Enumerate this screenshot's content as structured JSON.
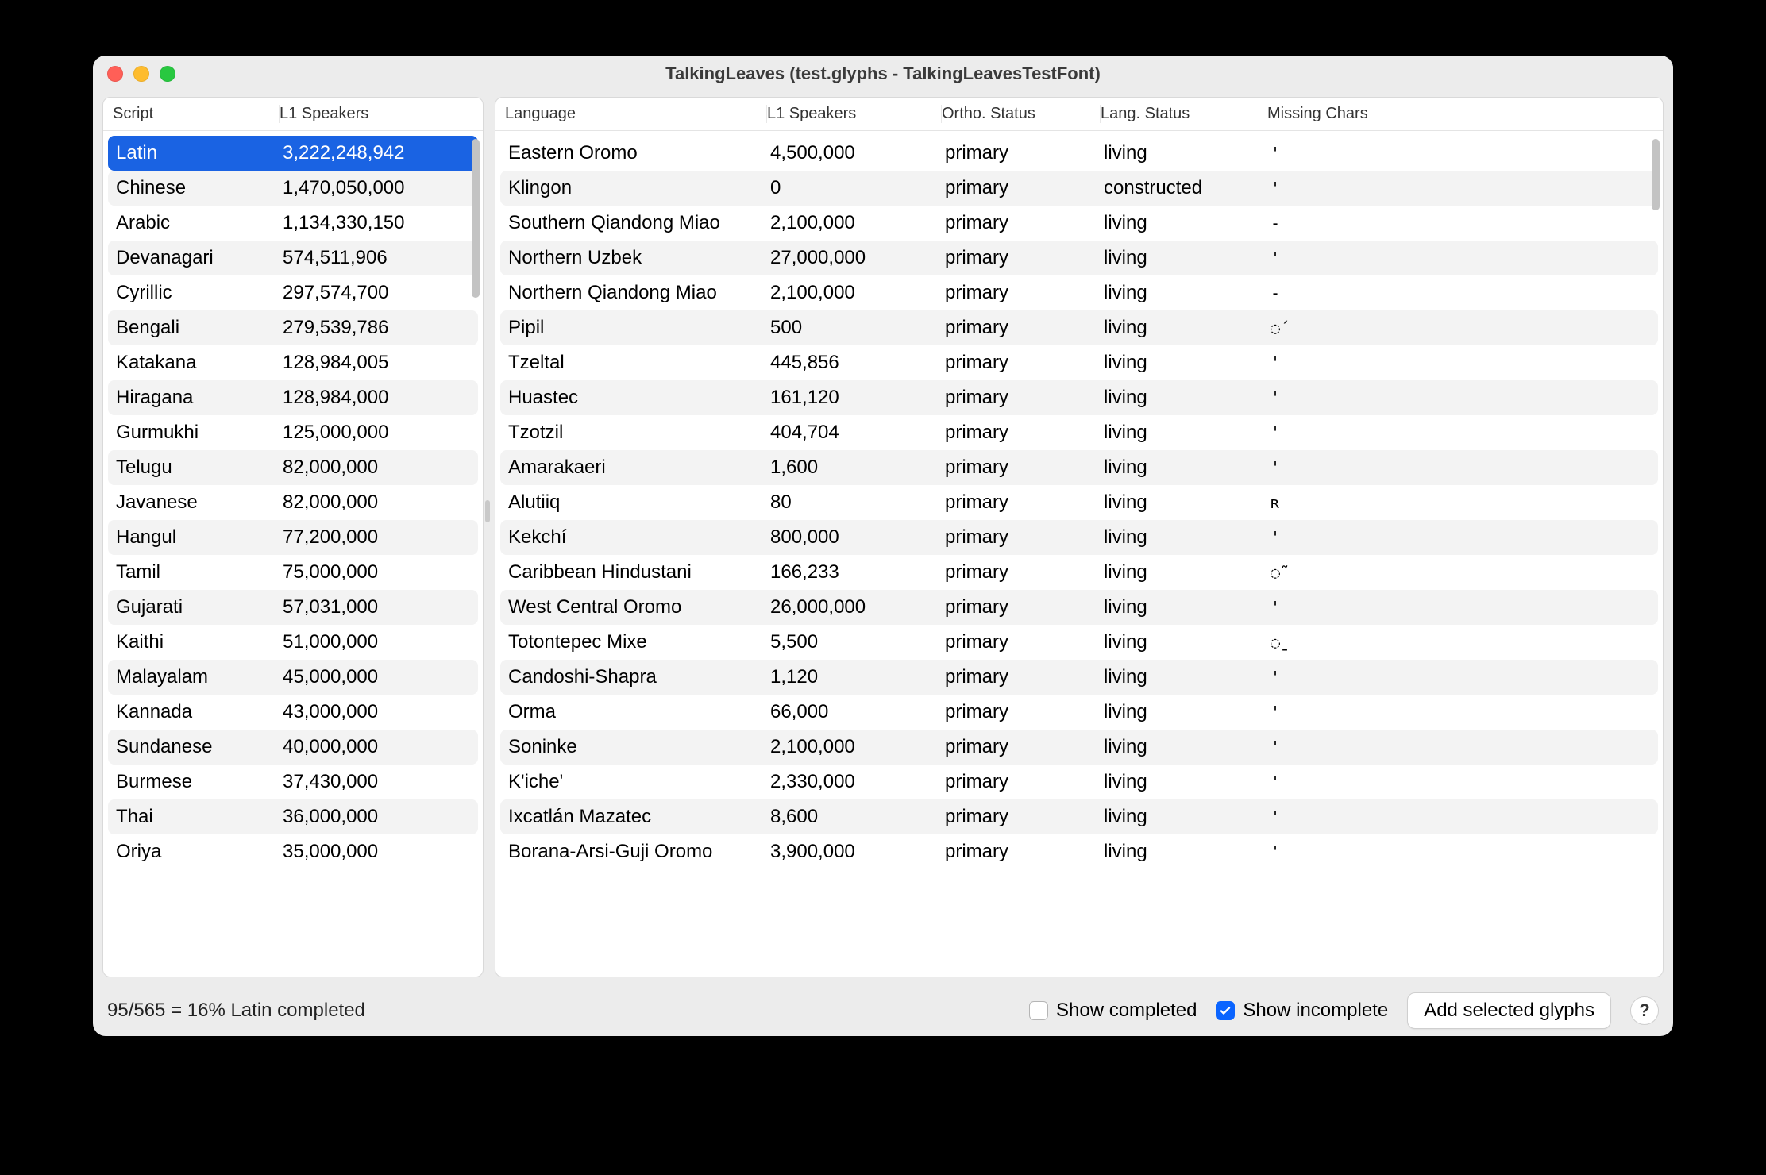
{
  "window": {
    "title": "TalkingLeaves (test.glyphs - TalkingLeavesTestFont)"
  },
  "left": {
    "headers": {
      "script": "Script",
      "speakers": "L1 Speakers"
    },
    "selected_index": 0,
    "rows": [
      {
        "script": "Latin",
        "speakers": "3,222,248,942"
      },
      {
        "script": "Chinese",
        "speakers": "1,470,050,000"
      },
      {
        "script": "Arabic",
        "speakers": "1,134,330,150"
      },
      {
        "script": "Devanagari",
        "speakers": "574,511,906"
      },
      {
        "script": "Cyrillic",
        "speakers": "297,574,700"
      },
      {
        "script": "Bengali",
        "speakers": "279,539,786"
      },
      {
        "script": "Katakana",
        "speakers": "128,984,005"
      },
      {
        "script": "Hiragana",
        "speakers": "128,984,000"
      },
      {
        "script": "Gurmukhi",
        "speakers": "125,000,000"
      },
      {
        "script": "Telugu",
        "speakers": "82,000,000"
      },
      {
        "script": "Javanese",
        "speakers": "82,000,000"
      },
      {
        "script": "Hangul",
        "speakers": "77,200,000"
      },
      {
        "script": "Tamil",
        "speakers": "75,000,000"
      },
      {
        "script": "Gujarati",
        "speakers": "57,031,000"
      },
      {
        "script": "Kaithi",
        "speakers": "51,000,000"
      },
      {
        "script": "Malayalam",
        "speakers": "45,000,000"
      },
      {
        "script": "Kannada",
        "speakers": "43,000,000"
      },
      {
        "script": "Sundanese",
        "speakers": "40,000,000"
      },
      {
        "script": "Burmese",
        "speakers": "37,430,000"
      },
      {
        "script": "Thai",
        "speakers": "36,000,000"
      },
      {
        "script": "Oriya",
        "speakers": "35,000,000"
      }
    ]
  },
  "right": {
    "headers": {
      "language": "Language",
      "speakers": "L1 Speakers",
      "ortho": "Ortho. Status",
      "status": "Lang. Status",
      "missing": "Missing Chars"
    },
    "rows": [
      {
        "language": "Eastern Oromo",
        "speakers": "4,500,000",
        "ortho": "primary",
        "status": "living",
        "missing": "'"
      },
      {
        "language": "Klingon",
        "speakers": "0",
        "ortho": "primary",
        "status": "constructed",
        "missing": "'"
      },
      {
        "language": "Southern Qiandong Miao",
        "speakers": "2,100,000",
        "ortho": "primary",
        "status": "living",
        "missing": "-"
      },
      {
        "language": "Northern Uzbek",
        "speakers": "27,000,000",
        "ortho": "primary",
        "status": "living",
        "missing": "'"
      },
      {
        "language": "Northern Qiandong Miao",
        "speakers": "2,100,000",
        "ortho": "primary",
        "status": "living",
        "missing": "-"
      },
      {
        "language": "Pipil",
        "speakers": "500",
        "ortho": "primary",
        "status": "living",
        "missing": "◌́"
      },
      {
        "language": "Tzeltal",
        "speakers": "445,856",
        "ortho": "primary",
        "status": "living",
        "missing": "'"
      },
      {
        "language": "Huastec",
        "speakers": "161,120",
        "ortho": "primary",
        "status": "living",
        "missing": "'"
      },
      {
        "language": "Tzotzil",
        "speakers": "404,704",
        "ortho": "primary",
        "status": "living",
        "missing": "'"
      },
      {
        "language": "Amarakaeri",
        "speakers": "1,600",
        "ortho": "primary",
        "status": "living",
        "missing": "'"
      },
      {
        "language": "Alutiiq",
        "speakers": "80",
        "ortho": "primary",
        "status": "living",
        "missing": "ʀ"
      },
      {
        "language": "Kekchí",
        "speakers": "800,000",
        "ortho": "primary",
        "status": "living",
        "missing": "'"
      },
      {
        "language": "Caribbean Hindustani",
        "speakers": "166,233",
        "ortho": "primary",
        "status": "living",
        "missing": "◌̃"
      },
      {
        "language": "West Central Oromo",
        "speakers": "26,000,000",
        "ortho": "primary",
        "status": "living",
        "missing": "'"
      },
      {
        "language": "Totontepec Mixe",
        "speakers": "5,500",
        "ortho": "primary",
        "status": "living",
        "missing": "◌̱"
      },
      {
        "language": "Candoshi-Shapra",
        "speakers": "1,120",
        "ortho": "primary",
        "status": "living",
        "missing": "'"
      },
      {
        "language": "Orma",
        "speakers": "66,000",
        "ortho": "primary",
        "status": "living",
        "missing": "'"
      },
      {
        "language": "Soninke",
        "speakers": "2,100,000",
        "ortho": "primary",
        "status": "living",
        "missing": "'"
      },
      {
        "language": "K'iche'",
        "speakers": "2,330,000",
        "ortho": "primary",
        "status": "living",
        "missing": "'"
      },
      {
        "language": "Ixcatlán Mazatec",
        "speakers": "8,600",
        "ortho": "primary",
        "status": "living",
        "missing": "'"
      },
      {
        "language": "Borana-Arsi-Guji Oromo",
        "speakers": "3,900,000",
        "ortho": "primary",
        "status": "living",
        "missing": "'"
      }
    ]
  },
  "footer": {
    "status": "95/565 = 16% Latin completed",
    "show_completed": {
      "label": "Show completed",
      "checked": false
    },
    "show_incomplete": {
      "label": "Show incomplete",
      "checked": true
    },
    "add_button": "Add selected glyphs",
    "help": "?"
  }
}
